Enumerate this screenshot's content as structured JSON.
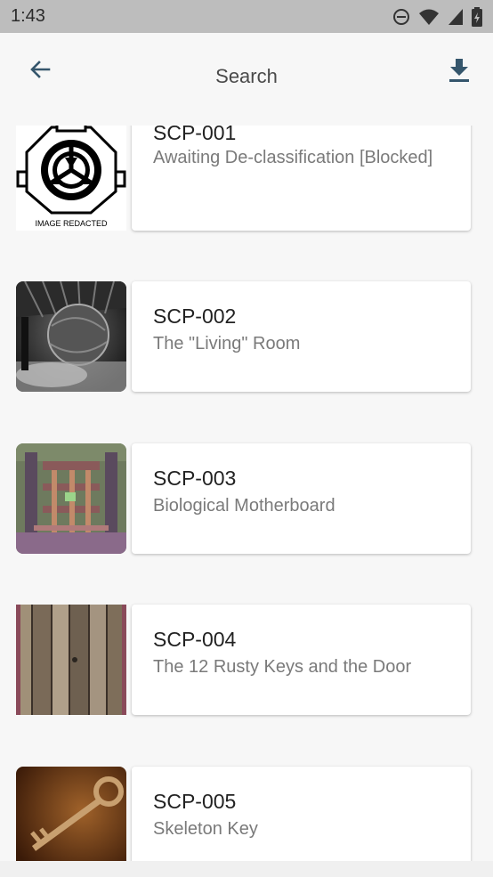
{
  "status_bar": {
    "time": "1:43",
    "icons": [
      "do-not-disturb-icon",
      "wifi-icon",
      "signal-icon",
      "battery-icon"
    ]
  },
  "app_bar": {
    "title": "Search",
    "back_icon": "arrow-left-icon",
    "download_icon": "download-icon"
  },
  "items": [
    {
      "number": "SCP-001",
      "title": "Awaiting De-classification [Blocked]",
      "thumb_caption": "IMAGE REDACTED"
    },
    {
      "number": "SCP-002",
      "title": "The \"Living\" Room"
    },
    {
      "number": "SCP-003",
      "title": "Biological Motherboard"
    },
    {
      "number": "SCP-004",
      "title": "The 12 Rusty Keys and the Door"
    },
    {
      "number": "SCP-005",
      "title": "Skeleton Key"
    }
  ],
  "colors": {
    "status_bar": "#bdbdbd",
    "background": "#f7f7f7",
    "accent_icon": "#35566c",
    "card": "#ffffff"
  }
}
